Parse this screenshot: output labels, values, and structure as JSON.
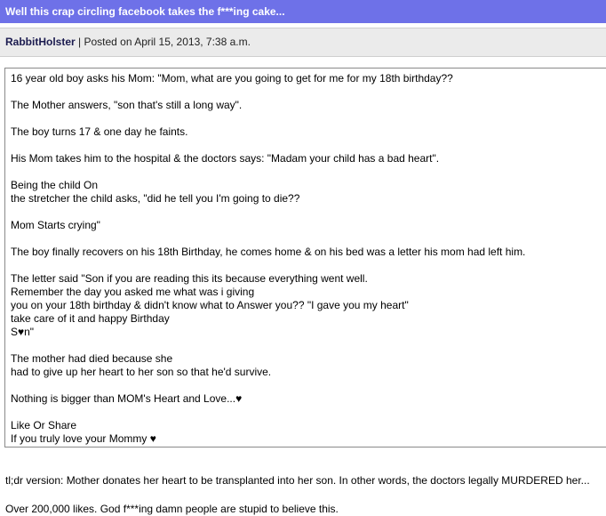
{
  "post": {
    "title": "Well this crap circling facebook takes the f***ing cake...",
    "author": "RabbitHolster",
    "separator": " | ",
    "posted": "Posted on April 15, 2013, 7:38 a.m."
  },
  "quote": {
    "paragraphs": [
      [
        "16 year old boy asks his Mom: \"Mom, what are you going to get for me for my 18th birthday??"
      ],
      [
        "The Mother answers, \"son that's still a long way\"."
      ],
      [
        "The boy turns 17 & one day he faints."
      ],
      [
        "His Mom takes him to the hospital & the doctors says: \"Madam your child has a bad heart\"."
      ],
      [
        "Being the child On",
        "the stretcher the child asks, \"did he tell you I'm going to die??"
      ],
      [
        "Mom Starts crying\""
      ],
      [
        "The boy finally recovers on his 18th Birthday, he comes home & on his bed was a letter his mom had left him."
      ],
      [
        "The letter said \"Son if you are reading this its because everything went well.",
        "Remember the day you asked me what was i giving",
        "you on your 18th birthday & didn't know what to Answer you?? \"I gave you my heart\"",
        "take care of it and happy Birthday",
        "S♥n\""
      ],
      [
        "The mother had died because she",
        "had to give up her heart to her son so that he'd survive."
      ],
      [
        "Nothing is bigger than MOM's Heart and Love...♥"
      ],
      [
        "Like Or Share",
        "If you truly love your Mommy ♥"
      ]
    ]
  },
  "comments": {
    "tldr": "tl;dr version: Mother donates her heart to be transplanted into her son. In other words, the doctors legally MURDERED her...",
    "likes": "Over 200,000 likes. God f***ing damn people are stupid to believe this."
  }
}
